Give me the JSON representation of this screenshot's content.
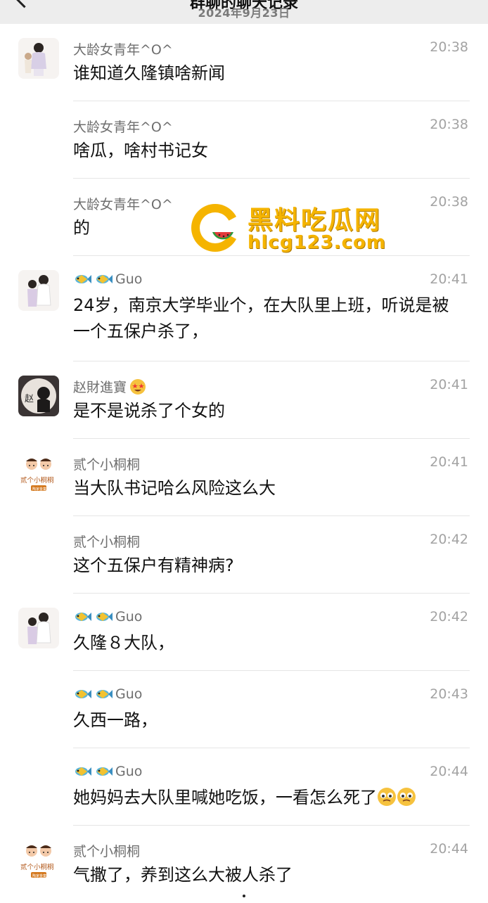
{
  "header": {
    "title": "群聊的聊天记录",
    "date": "2024年9月23日"
  },
  "messages": [
    {
      "name": "大龄女青年^O^",
      "time": "20:38",
      "text": "谁知道久隆镇啥新闻",
      "avatar": "couple-photo-avatar"
    },
    {
      "name": "大龄女青年^O^",
      "time": "20:38",
      "text": "啥瓜，啥村书记女"
    },
    {
      "name": "大龄女青年^O^",
      "time": "20:38",
      "text": "的"
    },
    {
      "name": "Guo",
      "time": "20:41",
      "text": "24岁，南京大学毕业个，在大队里上班，听说是被一个五保户杀了，",
      "avatar": "couple-photo-avatar"
    },
    {
      "name": "赵財進寶",
      "time": "20:41",
      "text": "是不是说杀了个女的",
      "avatar": "zhao-avatar"
    },
    {
      "name": "贰个小桐桐",
      "time": "20:41",
      "text": "当大队书记哈么风险这么大",
      "avatar": "cartoon-kids-avatar"
    },
    {
      "name": "贰个小桐桐",
      "time": "20:42",
      "text": "这个五保户有精神病?"
    },
    {
      "name": "Guo",
      "time": "20:42",
      "text": "久隆８大队，",
      "avatar": "couple-photo-avatar"
    },
    {
      "name": "Guo",
      "time": "20:43",
      "text": "久西一路，"
    },
    {
      "name": "Guo",
      "time": "20:44",
      "text": "她妈妈去大队里喊她吃饭，一看怎么死了"
    },
    {
      "name": "贰个小桐桐",
      "time": "20:44",
      "text": "气撒了，养到这么大被人杀了",
      "avatar": "cartoon-kids-avatar"
    }
  ],
  "watermark": {
    "title": "黑料吃瓜网",
    "url": "hlcg123.com"
  },
  "avatar_text": {
    "zhao": "赵",
    "kids_label": "贰个小桐桐",
    "kids_sub": "陶家金童"
  },
  "colors": {
    "name": "#6e6e6e",
    "time": "#a3a3a3",
    "watermark": "#f5b400"
  }
}
